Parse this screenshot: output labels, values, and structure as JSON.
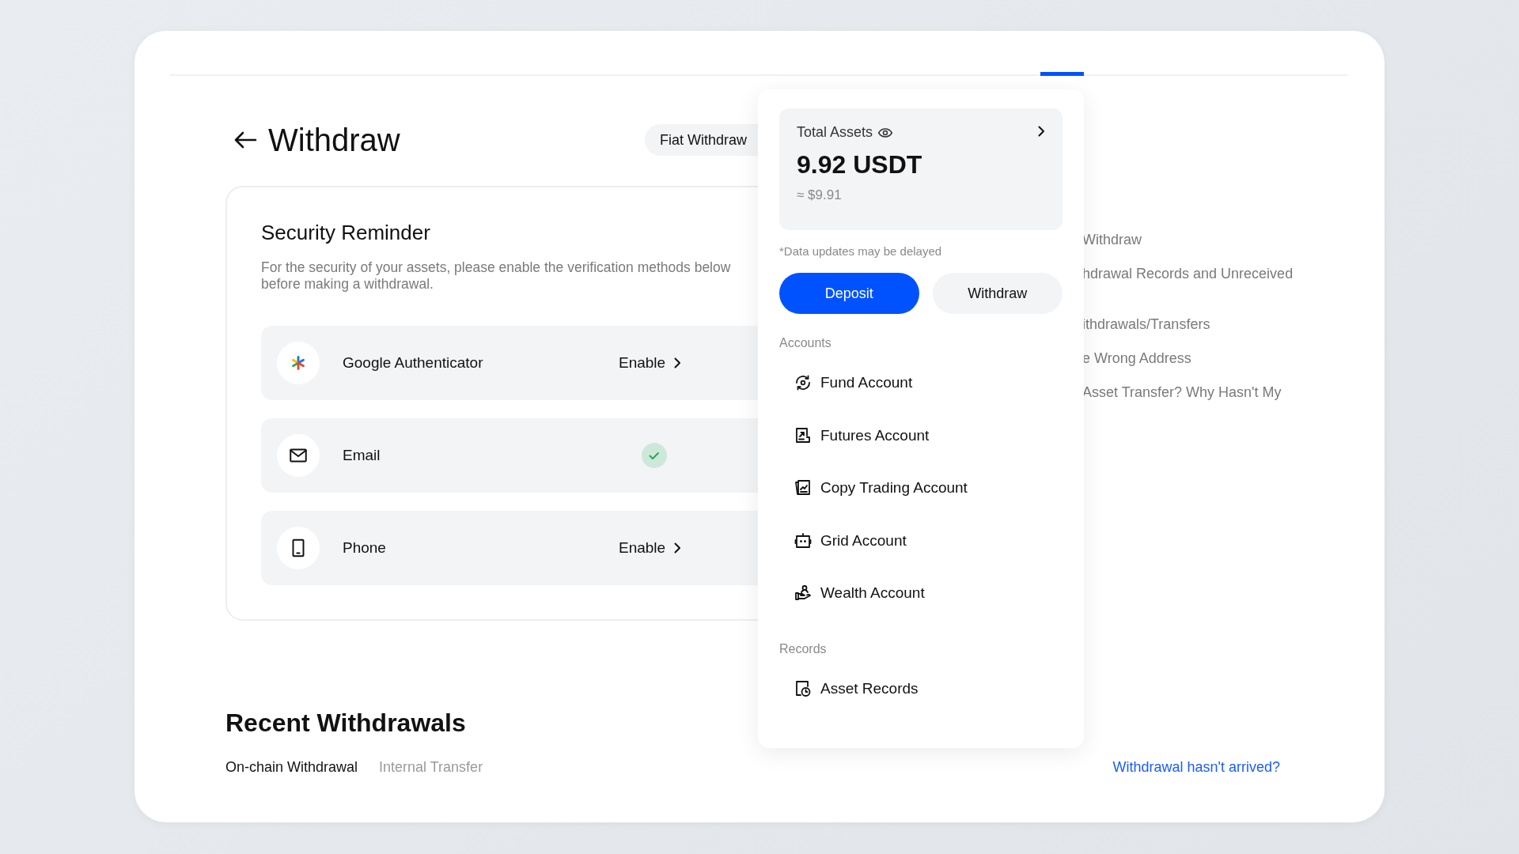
{
  "header": {
    "title": "Withdraw",
    "mode_tabs": [
      {
        "label": "Fiat Withdraw"
      }
    ]
  },
  "security": {
    "title": "Security Reminder",
    "description": "For the security of your assets, please enable the verification methods below before making a withdrawal.",
    "methods": [
      {
        "kind": "authenticator",
        "name": "Google Authenticator",
        "enabled": false,
        "action": "Enable"
      },
      {
        "kind": "email",
        "name": "Email",
        "enabled": true
      },
      {
        "kind": "phone",
        "name": "Phone",
        "enabled": false,
        "action": "Enable"
      }
    ]
  },
  "faq": [
    "Withdraw",
    "hdrawal Records and Unreceived",
    "ithdrawals/Transfers",
    "e Wrong Address",
    "Asset Transfer? Why Hasn't My"
  ],
  "recent": {
    "title": "Recent Withdrawals",
    "tabs": [
      {
        "label": "On-chain Withdrawal",
        "selected": true
      },
      {
        "label": "Internal Transfer",
        "selected": false
      }
    ],
    "help_link": "Withdrawal hasn't arrived?"
  },
  "assets_menu": {
    "title": "Total Assets",
    "amount": "9.92 USDT",
    "approx": "≈ $9.91",
    "note": "*Data updates may be delayed",
    "buttons": [
      {
        "label": "Deposit",
        "kind": "primary"
      },
      {
        "label": "Withdraw",
        "kind": "secondary"
      }
    ],
    "sections": [
      {
        "title": "Accounts",
        "items": [
          {
            "label": "Fund Account",
            "kind": "fund"
          },
          {
            "label": "Futures Account",
            "kind": "futures"
          },
          {
            "label": "Copy Trading Account",
            "kind": "copy"
          },
          {
            "label": "Grid Account",
            "kind": "grid"
          },
          {
            "label": "Wealth Account",
            "kind": "wealth"
          }
        ]
      },
      {
        "title": "Records",
        "items": [
          {
            "label": "Asset Records",
            "kind": "records"
          }
        ]
      }
    ]
  }
}
